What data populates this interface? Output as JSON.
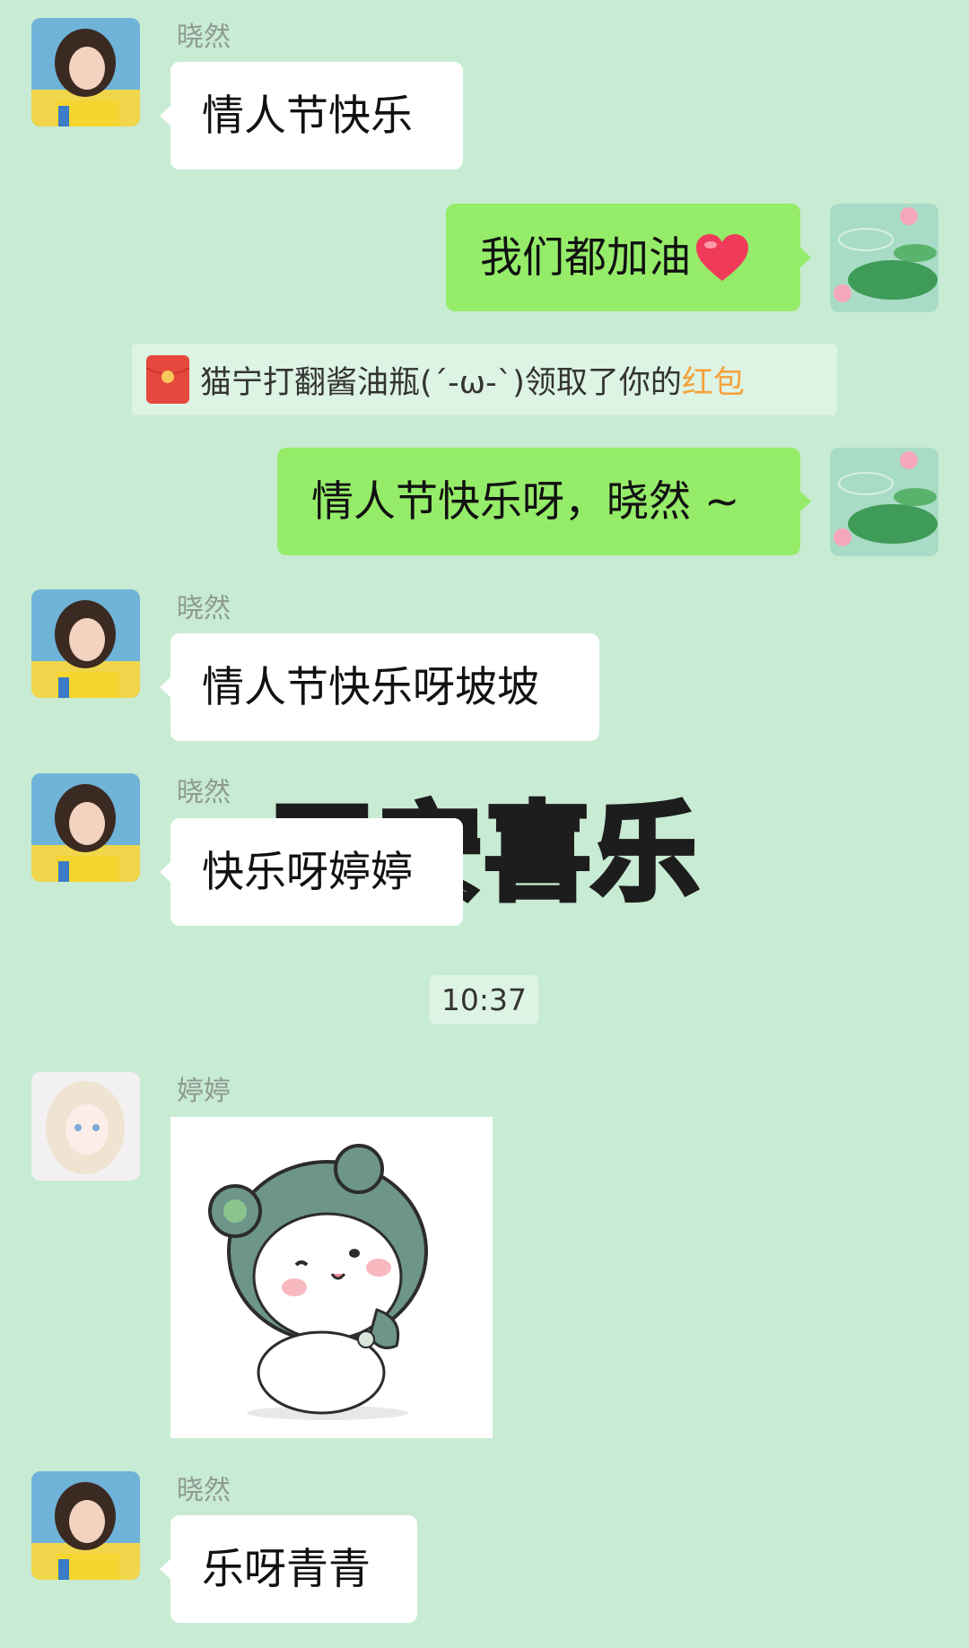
{
  "messages": {
    "m1": {
      "sender": "晓然",
      "text": "情人节快乐"
    },
    "m2": {
      "text": "我们都加油"
    },
    "system": {
      "prefix": "猫宁打翻酱油瓶(´-ω-`)领取了你的",
      "link": "红包"
    },
    "m3": {
      "text": "情人节快乐呀，晓然 ~"
    },
    "m4": {
      "sender": "晓然",
      "text": "情人节快乐呀坡坡"
    },
    "m5": {
      "sender": "晓然",
      "text": "快乐呀婷婷",
      "sticker_text": "平安喜乐"
    },
    "time": "10:37",
    "m6": {
      "sender": "婷婷"
    },
    "m7": {
      "sender": "晓然",
      "text": "乐呀青青"
    }
  },
  "icons": {
    "heart": "heart-emoji-icon",
    "red_packet": "red-packet-icon"
  },
  "colors": {
    "background": "#c8ebd3",
    "own_bubble": "#95ec69",
    "other_bubble": "#ffffff",
    "link": "#f5a13a",
    "red_packet": "#e6483d"
  }
}
